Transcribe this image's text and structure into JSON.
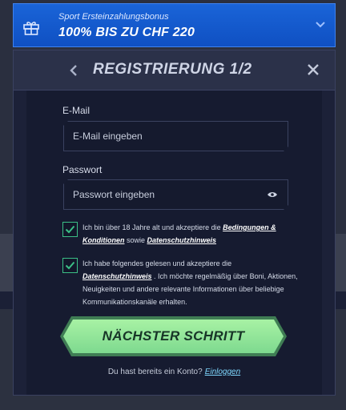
{
  "banner": {
    "subtitle": "Sport Ersteinzahlungsbonus",
    "headline": "100% BIS ZU CHF 220",
    "gift_icon": "gift-icon",
    "chevron_icon": "chevron-down-icon"
  },
  "modal": {
    "title": "REGISTRIERUNG 1/2",
    "back_icon": "chevron-left-icon",
    "close_icon": "close-icon"
  },
  "form": {
    "email_label": "E-Mail",
    "email_placeholder": "E-Mail eingeben",
    "password_label": "Passwort",
    "password_placeholder": "Passwort eingeben",
    "eye_icon": "eye-icon"
  },
  "consent1": {
    "checked": true,
    "text_a": "Ich bin über 18 Jahre alt und akzeptiere die ",
    "link_terms": "Bedingungen & Konditionen",
    "text_b": " sowie ",
    "link_privacy": "Datenschutzhinweis"
  },
  "consent2": {
    "checked": true,
    "text_a": "Ich habe folgendes gelesen und akzeptiere die ",
    "link_privacy": "Datenschutzhinweis",
    "text_b": " . Ich möchte regelmäßig über Boni, Aktionen, Neuigkeiten und andere relevante Informationen über beliebige Kommunikationskanäle erhalten."
  },
  "actions": {
    "next_label": "NÄCHSTER SCHRITT",
    "login_prompt": "Du hast bereits ein Konto?",
    "login_link": "Einloggen"
  },
  "colors": {
    "banner_blue": "#1a64d8",
    "modal_bg": "#1a1f35",
    "check_green": "#3bbf86",
    "button_green": "#a8f2a4",
    "link_blue": "#7fd8ff"
  }
}
